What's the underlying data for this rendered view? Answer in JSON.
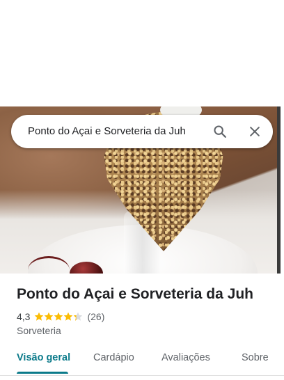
{
  "search": {
    "query": "Ponto do Açai e Sorveteria da Juh",
    "search_icon": "search-icon",
    "close_icon": "close-icon"
  },
  "place": {
    "name": "Ponto do Açai e Sorveteria da Juh",
    "rating": "4,3",
    "stars": 4.3,
    "reviews": "(26)",
    "category": "Sorveteria"
  },
  "tabs": [
    {
      "label": "Visão geral",
      "active": true
    },
    {
      "label": "Cardápio",
      "active": false
    },
    {
      "label": "Avaliações",
      "active": false
    },
    {
      "label": "Sobre",
      "active": false
    }
  ],
  "colors": {
    "star": "#fbbc04",
    "star_empty": "#dadce0",
    "accent": "#0b7a8a"
  }
}
